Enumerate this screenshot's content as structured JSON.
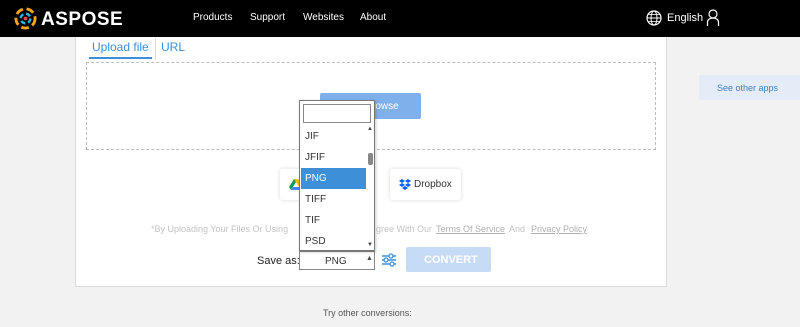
{
  "header": {
    "brand": "ASPOSE",
    "nav": [
      "Products",
      "Support",
      "Websites",
      "About"
    ],
    "language": "English",
    "icons": {
      "logo": "aspose-logo-icon",
      "language": "globe-icon",
      "account": "user-icon"
    }
  },
  "upload": {
    "tabs": [
      "Upload file",
      "URL"
    ],
    "active_tab": "Upload file",
    "browse_label": "rowse",
    "cloud_sources": {
      "google_drive_icon": "google-drive-icon",
      "dropbox_label": "Dropbox"
    }
  },
  "terms": {
    "prefix": "*By Uploading Your Files Or Using ",
    "middle": "gree With Our ",
    "tos": "Terms Of Service",
    "and": " And ",
    "privacy": "Privacy Policy"
  },
  "conversion": {
    "save_as_label": "Save as:",
    "selected_format": "PNG",
    "convert_label": "CONVERT"
  },
  "dropdown": {
    "search_value": "",
    "options": [
      "JIF",
      "JFIF",
      "PNG",
      "TIFF",
      "TIF",
      "PSD"
    ],
    "selected_index": 2
  },
  "sidebar": {
    "see_other_apps": "See other apps"
  },
  "footer": {
    "try_other": "Try other conversions:"
  },
  "colors": {
    "accent": "#3d8fd8",
    "topbar": "#000000",
    "convert_disabled": "#c6dbf6"
  }
}
